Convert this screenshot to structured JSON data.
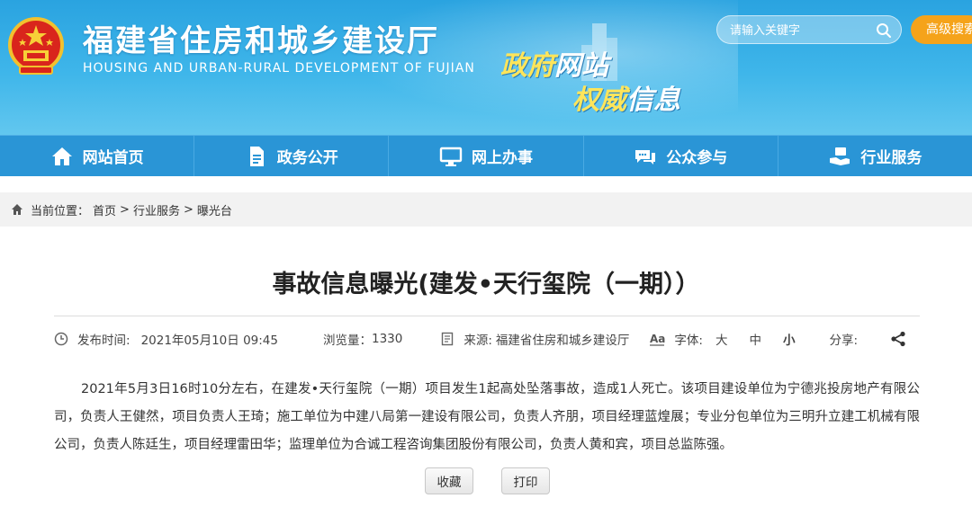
{
  "header": {
    "site_title": "福建省住房和城乡建设厅",
    "site_subtitle": "HOUSING AND URBAN-RURAL DEVELOPMENT OF FUJIAN",
    "slogan_line1_a": "政府",
    "slogan_line1_b": "网站",
    "slogan_line2_a": "权威",
    "slogan_line2_b": "信息",
    "search_placeholder": "请输入关键字",
    "advanced_search_label": "高级搜索",
    "colors": {
      "banner": "#3fb6ea",
      "nav": "#2a95d6",
      "accent": "#f5a31a"
    }
  },
  "nav": {
    "items": [
      {
        "label": "网站首页",
        "icon": "home-icon"
      },
      {
        "label": "政务公开",
        "icon": "document-icon"
      },
      {
        "label": "网上办事",
        "icon": "monitor-icon"
      },
      {
        "label": "公众参与",
        "icon": "chat-icon"
      },
      {
        "label": "行业服务",
        "icon": "handshake-icon"
      }
    ]
  },
  "breadcrumb": {
    "prefix": "当前位置：",
    "items": [
      "首页",
      "行业服务",
      "曝光台"
    ],
    "sep": ">"
  },
  "article": {
    "title": "事故信息曝光(建发•天行玺院（一期））",
    "publish_label": "发布时间:",
    "publish_time": "2021年05月10日 09:45",
    "views_label": "浏览量：",
    "views": "1330",
    "source_label": "来源:",
    "source": "福建省住房和城乡建设厅",
    "font_label": "字体:",
    "font_sizes": [
      "大",
      "中",
      "小"
    ],
    "share_label": "分享:",
    "body": "2021年5月3日16时10分左右，在建发•天行玺院（一期）项目发生1起高处坠落事故，造成1人死亡。该项目建设单位为宁德兆投房地产有限公司，负责人王健然，项目负责人王琦；施工单位为中建八局第一建设有限公司，负责人齐朋，项目经理蓝煌展；专业分包单位为三明升立建工机械有限公司，负责人陈廷生，项目经理雷田华；监理单位为合诚工程咨询集团股份有限公司，负责人黄和宾，项目总监陈强。",
    "favorite_label": "收藏",
    "print_label": "打印"
  }
}
